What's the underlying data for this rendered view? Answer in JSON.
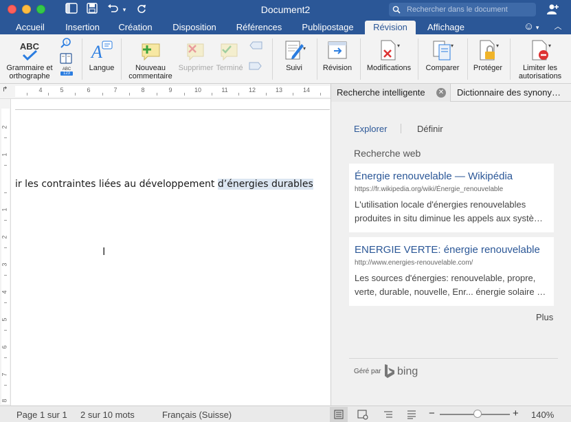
{
  "window": {
    "title": "Document2",
    "search_placeholder": "Rechercher dans le document"
  },
  "tabs": [
    {
      "label": "Accueil"
    },
    {
      "label": "Insertion"
    },
    {
      "label": "Création"
    },
    {
      "label": "Disposition"
    },
    {
      "label": "Références"
    },
    {
      "label": "Publipostage"
    },
    {
      "label": "Révision",
      "active": true
    },
    {
      "label": "Affichage"
    }
  ],
  "ribbon": {
    "grammar_line1": "Grammaire et",
    "grammar_line2": "orthographe",
    "language": "Langue",
    "new_comment_line1": "Nouveau",
    "new_comment_line2": "commentaire",
    "delete": "Supprimer",
    "done": "Terminé",
    "track": "Suivi",
    "review": "Révision",
    "changes": "Modifications",
    "compare": "Comparer",
    "protect": "Protéger",
    "restrict_line1": "Limiter les",
    "restrict_line2": "autorisations",
    "abc_label": "ABC",
    "abc_small": "ABC",
    "abc_num": "123"
  },
  "ruler": {
    "numbers": [
      "4",
      "5",
      "6",
      "7",
      "8",
      "9",
      "10",
      "11",
      "12",
      "13",
      "14"
    ],
    "vnumbers": [
      "2",
      "1",
      "1",
      "2",
      "3",
      "4",
      "5",
      "6",
      "7",
      "8"
    ]
  },
  "document": {
    "text_before": "ir les contraintes liées au développement ",
    "text_selected": "d’énergies durables"
  },
  "pane": {
    "tab_smart": "Recherche intelligente",
    "tab_synonyms": "Dictionnaire des synony…",
    "explore": "Explorer",
    "define": "Définir",
    "web_title": "Recherche web",
    "results": [
      {
        "title": "Énergie renouvelable — Wikipédia",
        "url": "https://fr.wikipedia.org/wiki/Énergie_renouvelable",
        "desc": "L'utilisation locale d'énergies renouvelables produites in situ diminue les appels aux systè…"
      },
      {
        "title": "ENERGIE VERTE: énergie renouvelable",
        "url": "http://www.energies-renouvelable.com/",
        "desc": "Les sources d'énergies: renouvelable, propre, verte, durable, nouvelle, Enr... énergie solaire …"
      }
    ],
    "more": "Plus",
    "powered_by": "Géré par",
    "bing": "bing"
  },
  "status": {
    "page": "Page 1 sur 1",
    "words": "2 sur 10 mots",
    "language": "Français (Suisse)",
    "zoom": "140%",
    "zoom_level_percent": 140
  },
  "colors": {
    "accent": "#2b5797",
    "selection": "#dce6f2"
  }
}
